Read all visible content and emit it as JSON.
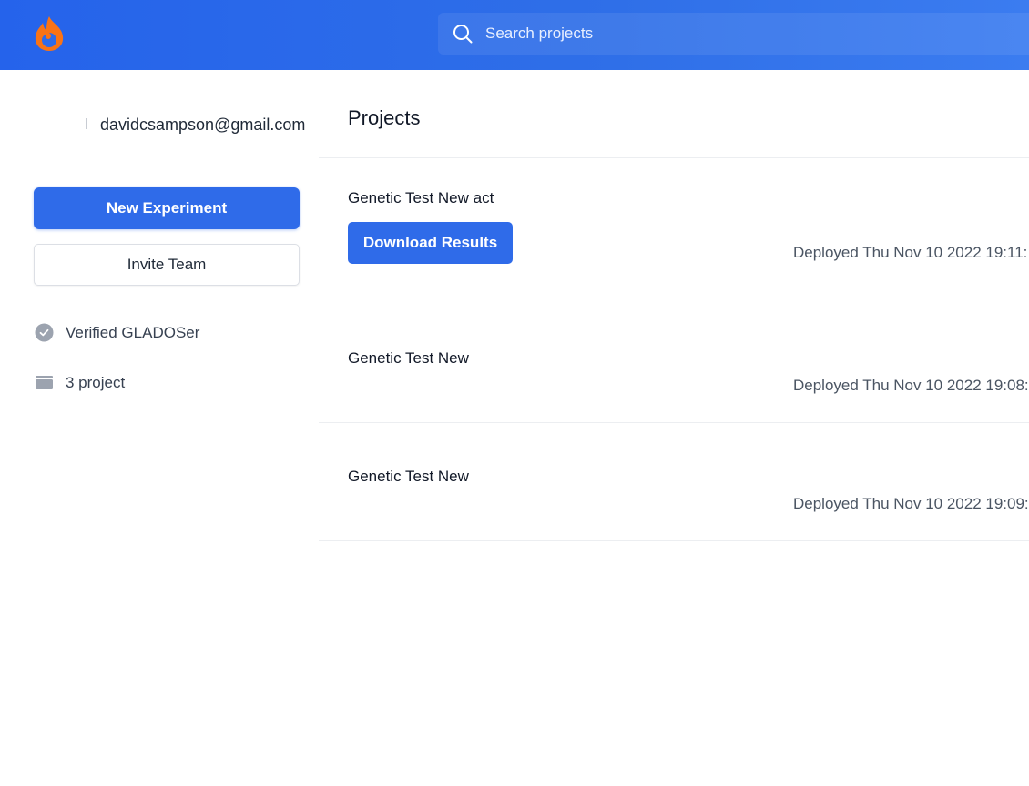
{
  "app": {
    "logo_icon": "flame-logo-icon",
    "accent_color": "#2f6be9",
    "logo_color": "#f97316"
  },
  "search": {
    "placeholder": "Search projects",
    "icon": "search-icon"
  },
  "sidebar": {
    "email": "davidcsampson@gmail.com",
    "new_experiment_label": "New Experiment",
    "invite_team_label": "Invite Team",
    "verified_label": "Verified GLADOSer",
    "verified_icon": "check-circle-icon",
    "project_count_label": "3 project",
    "project_count_icon": "folder-icon"
  },
  "main": {
    "title": "Projects",
    "projects": [
      {
        "name": "Genetic Test New act",
        "action_label": "Download Results",
        "deployed": "Deployed Thu Nov 10 2022 19:11:"
      },
      {
        "name": "Genetic Test New",
        "deployed": "Deployed Thu Nov 10 2022 19:08:"
      },
      {
        "name": "Genetic Test New",
        "deployed": "Deployed Thu Nov 10 2022 19:09:"
      }
    ]
  }
}
